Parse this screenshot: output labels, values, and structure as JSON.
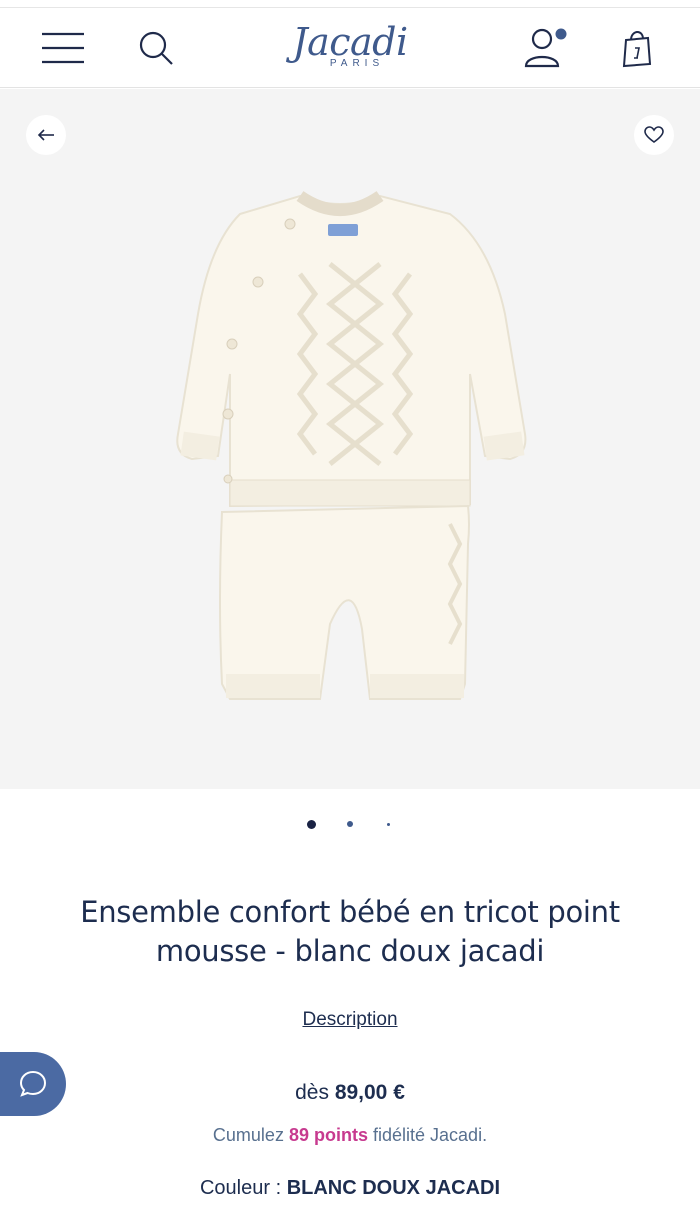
{
  "brand": {
    "name": "Jacadi",
    "sub": "PARIS",
    "color": "#3f5a8c"
  },
  "header": {
    "menu_icon": "hamburger-menu-icon",
    "search_icon": "search-icon",
    "account_icon": "user-account-icon",
    "bag_icon": "shopping-bag-icon"
  },
  "gallery": {
    "back_icon": "arrow-left-icon",
    "favorite_icon": "heart-icon",
    "product_image": "Knit baby sweater and trousers set, soft white",
    "dots_count": 3,
    "active_dot": 1
  },
  "product": {
    "title": "Ensemble confort bébé en tricot point mousse - blanc doux jacadi",
    "description_link": "Description",
    "price_prefix": "dès",
    "price": "89,00 €",
    "points_prefix": "Cumulez",
    "points": "89 points",
    "points_suffix": "fidélité Jacadi.",
    "color_label": "Couleur :",
    "color_value": "BLANC DOUX JACADI"
  },
  "chat": {
    "icon": "chat-bubble-icon"
  },
  "colors": {
    "accent": "#4b6aa3",
    "points": "#c73a8f",
    "text": "#1d2d4f"
  }
}
